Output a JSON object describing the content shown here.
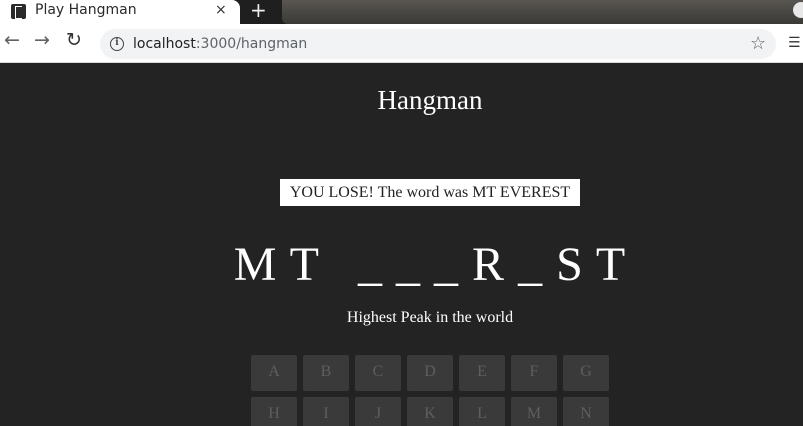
{
  "browser": {
    "tab_title": "Play Hangman",
    "tab_close": "×",
    "new_tab": "+",
    "url_host": "localhost",
    "url_path": ":3000/hangman"
  },
  "page": {
    "title": "Hangman",
    "status": "YOU LOSE! The word was MT EVEREST",
    "word_display": "M T   _ _ _ R _ S T",
    "hint": "Highest Peak in the world"
  },
  "keyboard": {
    "row1": [
      "A",
      "B",
      "C",
      "D",
      "E",
      "F",
      "G"
    ],
    "row2": [
      "H",
      "I",
      "J",
      "K",
      "L",
      "M",
      "N"
    ]
  },
  "icons": [
    "back-arrow-icon",
    "forward-arrow-icon",
    "reload-icon",
    "info-icon",
    "star-icon",
    "extension-icon",
    "favicon"
  ]
}
